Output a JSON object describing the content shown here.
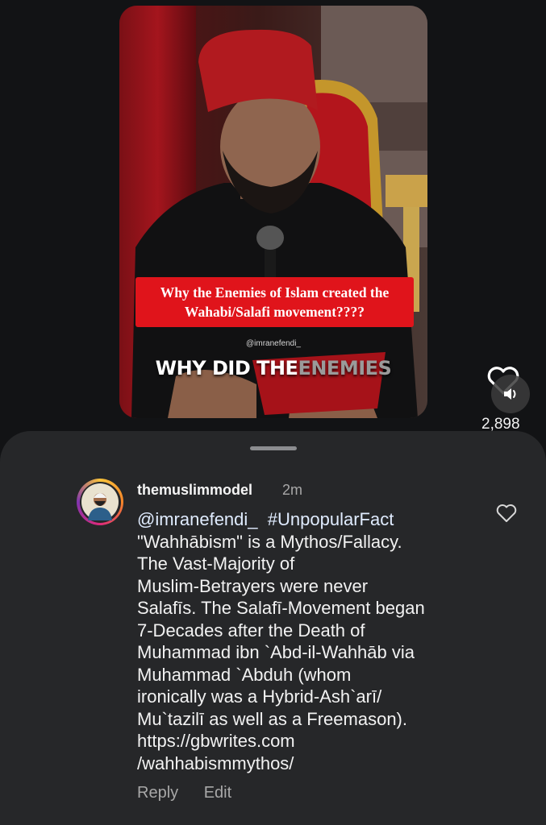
{
  "video": {
    "caption_banner": "Why the Enemies of Islam created the Wahabi/Salafi movement????",
    "watermark": "@imranefendi_",
    "subtitle_white": "WHY DID THE",
    "subtitle_highlight": "ENEMIES"
  },
  "rail": {
    "like_icon": "heart-outline-icon",
    "mute_icon": "speaker-icon",
    "like_count": "2,898"
  },
  "comment": {
    "username": "themuslimmodel",
    "timestamp": "2m",
    "mention": "@imranefendi_",
    "hashtag": "#UnpopularFact",
    "lines": [
      "\"Wahhābism\" is a Mythos/Fallacy.",
      "The Vast-Majority of",
      "Muslim-Betrayers were never",
      "Salafīs. The Salafī-Movement began",
      "7-Decades after the Death of",
      "Muhammad ibn `Abd-il-Wahhāb via",
      "Muhammad `Abduh (whom",
      "ironically was a Hybrid-Ash`arī/",
      "Mu`tazilī as well as a Freemason).",
      "https://gbwrites.com",
      "/wahhabismmythos/"
    ],
    "reply_label": "Reply",
    "edit_label": "Edit",
    "like_icon": "heart-outline-icon"
  },
  "colors": {
    "background": "#121315",
    "sheet": "#262729",
    "banner_red": "#e0141b",
    "muted_text": "#a8a8a8"
  }
}
